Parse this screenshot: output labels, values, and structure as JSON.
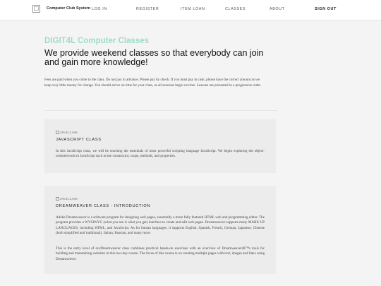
{
  "header": {
    "brand": "Computer Club System",
    "nav": [
      {
        "label": "LOG IN"
      },
      {
        "label": "REGISTER"
      },
      {
        "label": "ITEM LOAN"
      },
      {
        "label": "CLASSES"
      },
      {
        "label": "ABOUT"
      },
      {
        "label": "SIGN OUT"
      }
    ]
  },
  "hero": {
    "title": "DIGIT4L Computer Classes",
    "subtitle": "We provide weekend classes so that everybody can join and gain more knowledge!"
  },
  "intro": "Fees are paid when you come to the class. Do not pay in advance. Please pay by check. If you must pay in cash, please have the correct amount as we keep very little money for change. You should arrive on time for your class, as all sessions begin on time. Lessons are presented in a progressive order.",
  "classes": [
    {
      "image_alt": "JAVACLASS",
      "title": "JAVASCRIPT CLASS",
      "paragraphs": [
        "In this JavaScript class, we will be teaching the essentials of most powerful scripting language JavaScript. We begin exploring the object-oriented tools in JavaScript such as the constructor, scope, methods, and properties."
      ]
    },
    {
      "image_alt": "JAVACLASS",
      "title": "DREAMWEAVER CLASS - INTRODUCTION",
      "paragraphs": [
        "Adobe Dreamweaver is a software program for designing web pages, essentially a more fully featured HTML web and programming editor. The program provides a WYSIWYG (what you see is what you get) interface to create and edit web pages. Dreamweaver supports many MARK UP LANGUAGES, including HTML, and JavaScript. As for human languages, it supports English, Spanish, French, German, Japanese, Chinese (both simplified and traditional), Italian, Russian, and many more.",
        "This is the entry level of ourDreamweaver class combines practical hands-on exercises with an overview of Dreamweaverâ€™s tools for building and maintaining websites in this two-day course. The focus of this course is on creating multiple pages with text, images and links using Dreamweaver."
      ]
    }
  ]
}
